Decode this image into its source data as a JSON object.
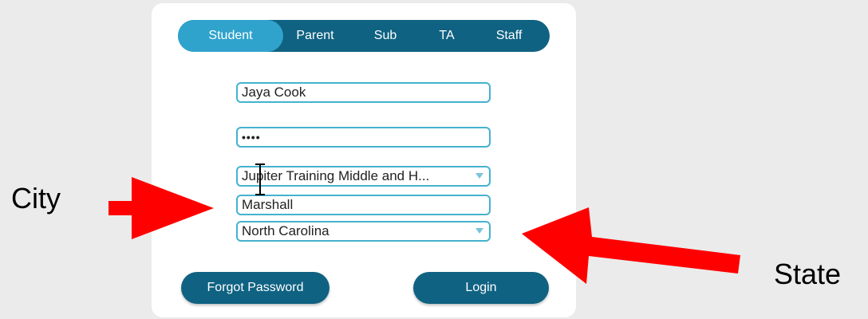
{
  "tabs": [
    {
      "label": "Student",
      "active": true
    },
    {
      "label": "Parent",
      "active": false
    },
    {
      "label": "Sub",
      "active": false
    },
    {
      "label": "TA",
      "active": false
    },
    {
      "label": "Staff",
      "active": false
    }
  ],
  "form": {
    "username_value": "Jaya Cook",
    "password_value": "••••",
    "school_value": "Jupiter Training Middle and H...",
    "city_value": "Marshall",
    "state_value": "North Carolina"
  },
  "buttons": {
    "forgot_label": "Forgot Password",
    "login_label": "Login"
  },
  "annotations": {
    "city_label": "City",
    "state_label": "State",
    "arrow_color": "#ff0000"
  },
  "colors": {
    "tab_bar": "#0f6282",
    "tab_active": "#2fa3cc",
    "field_border": "#45b2cf"
  },
  "icons": {
    "dropdown": "chevron-down-icon",
    "cursor": "text-cursor-icon"
  }
}
